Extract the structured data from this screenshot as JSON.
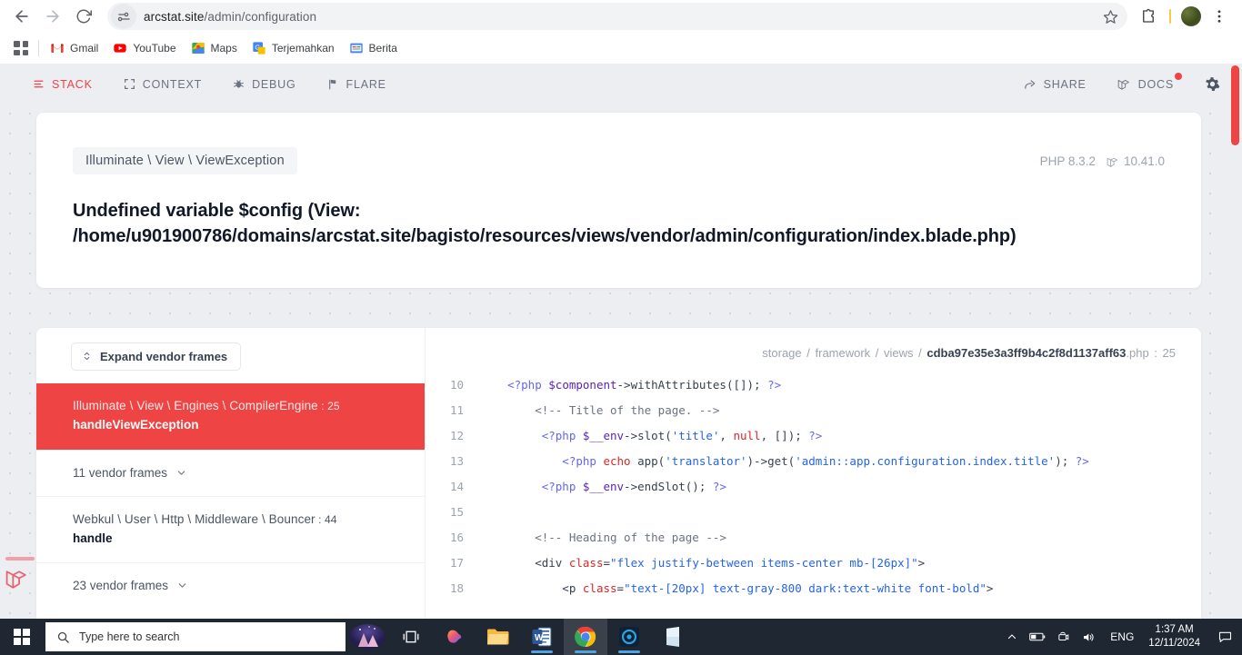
{
  "browser": {
    "url_domain": "arcstat.site",
    "url_path": "/admin/configuration",
    "back_icon": "back-arrow-icon",
    "forward_icon": "forward-arrow-icon",
    "reload_icon": "reload-icon",
    "site_info_icon": "site-settings-icon",
    "bookmark_icon": "star-icon",
    "extensions_icon": "extensions-puzzle-icon",
    "profile_icon": "profile-avatar",
    "menu_icon": "three-dot-menu-icon",
    "bookmarks": [
      {
        "label": "Gmail",
        "icon": "gmail-icon"
      },
      {
        "label": "YouTube",
        "icon": "youtube-icon"
      },
      {
        "label": "Maps",
        "icon": "maps-icon"
      },
      {
        "label": "Terjemahkan",
        "icon": "translate-icon"
      },
      {
        "label": "Berita",
        "icon": "news-icon"
      }
    ],
    "apps_label": "apps-grid-icon"
  },
  "flare": {
    "tabs": [
      {
        "label": "STACK",
        "icon": "stack-lines-icon",
        "active": true
      },
      {
        "label": "CONTEXT",
        "icon": "brackets-icon",
        "active": false
      },
      {
        "label": "DEBUG",
        "icon": "bug-icon",
        "active": false
      },
      {
        "label": "FLARE",
        "icon": "flare-flag-icon",
        "active": false
      }
    ],
    "actions": [
      {
        "label": "SHARE",
        "icon": "share-arrow-icon"
      },
      {
        "label": "DOCS",
        "icon": "laravel-icon",
        "badge": true
      }
    ],
    "settings_icon": "gear-icon",
    "accent_color": "#ef4444"
  },
  "exception": {
    "class": "Illuminate \\ View \\ ViewException",
    "message": "Undefined variable $config (View: /home/u901900786/domains/arcstat.site/bagisto/resources/views/vendor/admin/configuration/index.blade.php)",
    "php_version": "PHP 8.3.2",
    "laravel_version": "10.41.0"
  },
  "stack": {
    "expand_button": "Expand vendor frames",
    "expand_icon": "expand-chevrons-icon",
    "frames": [
      {
        "type": "app",
        "class": "Illuminate \\ View \\ Engines \\ CompilerEngine",
        "line": "25",
        "fn": "handleViewException",
        "active": true
      },
      {
        "type": "vendor",
        "label": "11 vendor frames",
        "icon": "chevron-down-icon"
      },
      {
        "type": "app",
        "class": "Webkul \\ User \\ Http \\ Middleware \\ Bouncer",
        "line": "44",
        "fn": "handle",
        "active": false
      },
      {
        "type": "vendor",
        "label": "23 vendor frames",
        "icon": "chevron-down-icon"
      }
    ]
  },
  "code": {
    "path_parts": [
      "storage",
      "framework",
      "views"
    ],
    "path_file": "cdba97e35e3a3ff9b4c2f8d1137aff63",
    "path_ext": ".php",
    "path_line": "25",
    "lines": [
      {
        "n": "10",
        "tokens": [
          {
            "t": "php",
            "v": "    <?php "
          },
          {
            "t": "var",
            "v": "$component"
          },
          {
            "t": "plain",
            "v": "->withAttributes([]); "
          },
          {
            "t": "php",
            "v": "?>"
          }
        ]
      },
      {
        "n": "11",
        "tokens": [
          {
            "t": "cmt",
            "v": "        <!-- Title of the page. -->"
          }
        ]
      },
      {
        "n": "12",
        "tokens": [
          {
            "t": "php",
            "v": "         <?php "
          },
          {
            "t": "var",
            "v": "$__env"
          },
          {
            "t": "plain",
            "v": "->slot("
          },
          {
            "t": "str",
            "v": "'title'"
          },
          {
            "t": "plain",
            "v": ", "
          },
          {
            "t": "null",
            "v": "null"
          },
          {
            "t": "plain",
            "v": ", []); "
          },
          {
            "t": "php",
            "v": "?>"
          }
        ]
      },
      {
        "n": "13",
        "tokens": [
          {
            "t": "php",
            "v": "            <?php "
          },
          {
            "t": "kw",
            "v": "echo"
          },
          {
            "t": "plain",
            "v": " app("
          },
          {
            "t": "str",
            "v": "'translator'"
          },
          {
            "t": "plain",
            "v": ")->get("
          },
          {
            "t": "str",
            "v": "'admin::app.configuration.index.title'"
          },
          {
            "t": "plain",
            "v": "); "
          },
          {
            "t": "php",
            "v": "?>"
          }
        ]
      },
      {
        "n": "14",
        "tokens": [
          {
            "t": "php",
            "v": "         <?php "
          },
          {
            "t": "var",
            "v": "$__env"
          },
          {
            "t": "plain",
            "v": "->endSlot(); "
          },
          {
            "t": "php",
            "v": "?>"
          }
        ]
      },
      {
        "n": "15",
        "tokens": [
          {
            "t": "plain",
            "v": ""
          }
        ]
      },
      {
        "n": "16",
        "tokens": [
          {
            "t": "cmt",
            "v": "        <!-- Heading of the page -->"
          }
        ]
      },
      {
        "n": "17",
        "tokens": [
          {
            "t": "plain",
            "v": "        <div "
          },
          {
            "t": "kw",
            "v": "class"
          },
          {
            "t": "plain",
            "v": "="
          },
          {
            "t": "str",
            "v": "\"flex justify-between items-center mb-[26px]\""
          },
          {
            "t": "plain",
            "v": ">"
          }
        ]
      },
      {
        "n": "18",
        "tokens": [
          {
            "t": "plain",
            "v": "            <p "
          },
          {
            "t": "kw",
            "v": "class"
          },
          {
            "t": "plain",
            "v": "="
          },
          {
            "t": "str",
            "v": "\"text-[20px] text-gray-800 dark:text-white font-bold\""
          },
          {
            "t": "plain",
            "v": ">"
          }
        ]
      }
    ]
  },
  "taskbar": {
    "start_icon": "windows-start-icon",
    "search_placeholder": "Type here to search",
    "search_icon": "search-icon",
    "widget_icon": "news-weather-widget-icon",
    "taskview_icon": "task-view-icon",
    "apps": [
      {
        "name": "copilot-icon"
      },
      {
        "name": "file-explorer-icon"
      },
      {
        "name": "word-icon"
      },
      {
        "name": "chrome-icon"
      },
      {
        "name": "teams-icon"
      },
      {
        "name": "store-icon"
      }
    ],
    "tray": {
      "chevron_icon": "show-hidden-icons-icon",
      "battery_icon": "battery-icon",
      "network_icon": "network-icon",
      "volume_icon": "volume-icon",
      "language": "ENG",
      "time": "1:37 AM",
      "date": "12/11/2024",
      "notification_icon": "action-center-icon"
    }
  }
}
